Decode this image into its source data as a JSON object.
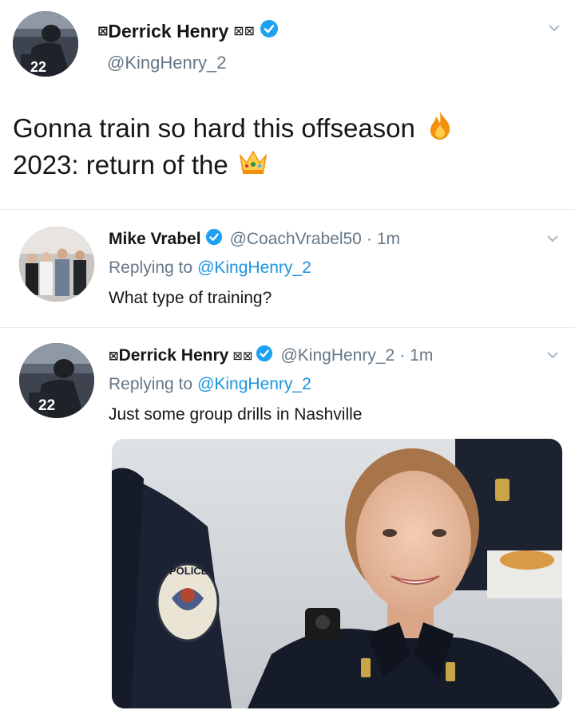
{
  "main_tweet": {
    "name": "Derrick Henry",
    "name_prefix_glyph": "⊠",
    "name_suffix_glyphs": "⊠⊠",
    "handle": "@KingHenry_2",
    "text_line1": "Gonna train so hard this offseason",
    "text_line2": "2023: return of the",
    "emoji1": "fire-emoji",
    "emoji2": "crown-emoji",
    "avatar_jersey_number": "22"
  },
  "reply1": {
    "name": "Mike Vrabel",
    "handle": "@CoachVrabel50",
    "dot": "·",
    "time": "1m",
    "replying_prefix": "Replying to",
    "replying_handle": "@KingHenry_2",
    "text": "What type of training?"
  },
  "reply2": {
    "name": "Derrick Henry",
    "name_prefix_glyph": "⊠",
    "name_suffix_glyphs": "⊠⊠",
    "handle": "@KingHenry_2",
    "dot": "·",
    "time": "1m",
    "replying_prefix": "Replying to",
    "replying_handle": "@KingHenry_2",
    "text": "Just some group drills in Nashville",
    "avatar_jersey_number": "22",
    "photo_patch_text": "POLICE"
  },
  "colors": {
    "verified_blue": "#1da1f2",
    "link_blue": "#1b95e0",
    "handle_gray": "#657786"
  }
}
